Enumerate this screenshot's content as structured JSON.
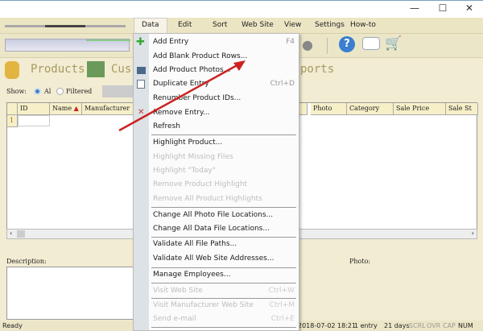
{
  "window": {
    "minimize": "—",
    "maximize": "☐",
    "close": "✕"
  },
  "menubar": [
    "Data",
    "Edit",
    "Sort",
    "Web Site",
    "View",
    "Settings",
    "How-to"
  ],
  "tabs": {
    "products": "Products",
    "customers": "Cus",
    "reports": "ports"
  },
  "show": {
    "label": "Show:",
    "all": "Al",
    "filtered": "Filtered"
  },
  "grid": {
    "columns": [
      "ID",
      "Name",
      "Manufacturer",
      "Photo",
      "Category",
      "Sale Price",
      "Sale St"
    ],
    "row_number": "1",
    "sort_indicator": "▲"
  },
  "description_label": "Description:",
  "photo_label": "Photo:",
  "status": {
    "left": "Ready",
    "date": "2018-07-02 18:21",
    "entries": "1 entry",
    "days": "21 days",
    "scrl": "SCRL",
    "ovr": "OVR",
    "cap": "CAP",
    "num": "NUM"
  },
  "menu": [
    {
      "label": "Add Entry",
      "shortcut": "F4",
      "icon": "add-icon"
    },
    {
      "label": "Add Blank Product Rows..."
    },
    {
      "label": "Add Product Photos...",
      "icon": "photo-icon"
    },
    {
      "label": "Duplicate Entry",
      "shortcut": "Ctrl+D",
      "icon": "duplicate-icon"
    },
    {
      "label": "Renumber Product IDs..."
    },
    {
      "label": "Remove Entry...",
      "icon": "remove-icon"
    },
    {
      "label": "Refresh"
    },
    {
      "label": "Highlight Product..."
    },
    {
      "label": "Highlight Missing Files",
      "disabled": true
    },
    {
      "label": "Highlight \"Today\"",
      "disabled": true
    },
    {
      "label": "Remove Product Highlight",
      "disabled": true
    },
    {
      "label": "Remove All Product Highlights",
      "disabled": true
    },
    {
      "label": "Change All Photo File Locations..."
    },
    {
      "label": "Change All Data File Locations..."
    },
    {
      "label": "Validate All File Paths..."
    },
    {
      "label": "Validate All Web Site Addresses..."
    },
    {
      "label": "Manage Employees..."
    },
    {
      "label": "Visit Web Site",
      "shortcut": "Ctrl+W",
      "disabled": true
    },
    {
      "label": "Visit Manufacturer Web Site",
      "shortcut": "Ctrl+M",
      "disabled": true
    },
    {
      "label": "Send e-mail",
      "shortcut": "Ctrl+E",
      "disabled": true
    }
  ],
  "colors": {
    "arrow": "#cc2222",
    "menu_bg": "#fbfbfb",
    "app_bg": "#f1ecd2"
  }
}
